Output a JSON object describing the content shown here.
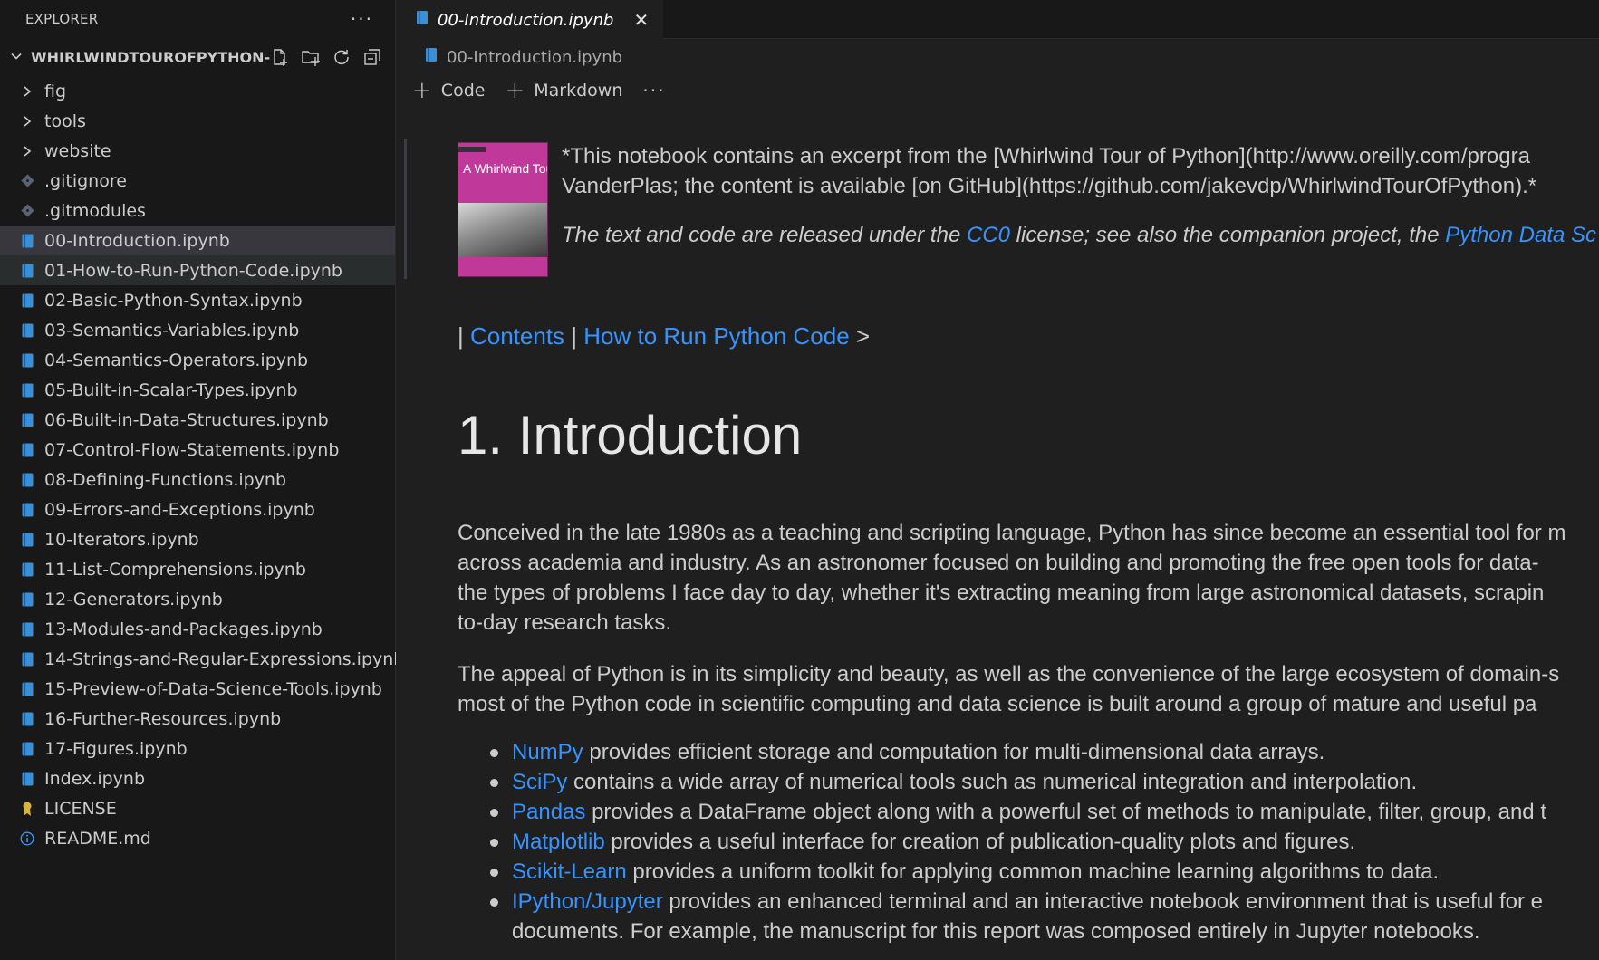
{
  "sidebar": {
    "title": "EXPLORER",
    "more": "···",
    "folder": "WHIRLWINDTOUROFPYTHON-...",
    "items": [
      {
        "label": "fig",
        "type": "folder"
      },
      {
        "label": "tools",
        "type": "folder"
      },
      {
        "label": "website",
        "type": "folder"
      },
      {
        "label": ".gitignore",
        "type": "git"
      },
      {
        "label": ".gitmodules",
        "type": "git"
      },
      {
        "label": "00-Introduction.ipynb",
        "type": "notebook",
        "state": "selected"
      },
      {
        "label": "01-How-to-Run-Python-Code.ipynb",
        "type": "notebook",
        "state": "hover"
      },
      {
        "label": "02-Basic-Python-Syntax.ipynb",
        "type": "notebook"
      },
      {
        "label": "03-Semantics-Variables.ipynb",
        "type": "notebook"
      },
      {
        "label": "04-Semantics-Operators.ipynb",
        "type": "notebook"
      },
      {
        "label": "05-Built-in-Scalar-Types.ipynb",
        "type": "notebook"
      },
      {
        "label": "06-Built-in-Data-Structures.ipynb",
        "type": "notebook"
      },
      {
        "label": "07-Control-Flow-Statements.ipynb",
        "type": "notebook"
      },
      {
        "label": "08-Defining-Functions.ipynb",
        "type": "notebook"
      },
      {
        "label": "09-Errors-and-Exceptions.ipynb",
        "type": "notebook"
      },
      {
        "label": "10-Iterators.ipynb",
        "type": "notebook"
      },
      {
        "label": "11-List-Comprehensions.ipynb",
        "type": "notebook"
      },
      {
        "label": "12-Generators.ipynb",
        "type": "notebook"
      },
      {
        "label": "13-Modules-and-Packages.ipynb",
        "type": "notebook"
      },
      {
        "label": "14-Strings-and-Regular-Expressions.ipynb",
        "type": "notebook"
      },
      {
        "label": "15-Preview-of-Data-Science-Tools.ipynb",
        "type": "notebook"
      },
      {
        "label": "16-Further-Resources.ipynb",
        "type": "notebook"
      },
      {
        "label": "17-Figures.ipynb",
        "type": "notebook"
      },
      {
        "label": "Index.ipynb",
        "type": "notebook"
      },
      {
        "label": "LICENSE",
        "type": "license"
      },
      {
        "label": "README.md",
        "type": "info"
      }
    ]
  },
  "editor": {
    "tab_label": "00-Introduction.ipynb",
    "breadcrumb": "00-Introduction.ipynb",
    "toolbar": {
      "code": "Code",
      "markdown": "Markdown",
      "more": "···"
    }
  },
  "notebook": {
    "cover": {
      "title": "A Whirlwind Tour of Python"
    },
    "intro_line1": "*This notebook contains an excerpt from the [Whirlwind Tour of Python](http://www.oreilly.com/progra",
    "intro_line2": "VanderPlas; the content is available [on GitHub](https://github.com/jakevdp/WhirlwindTourOfPython).*",
    "license": {
      "pre": "The text and code are released under the ",
      "link1": "CC0",
      "mid": " license; see also the companion project, the ",
      "link2": "Python Data Sc"
    },
    "nav": {
      "sep1": "| ",
      "contents": "Contents",
      "sep2": " | ",
      "next": "How to Run Python Code",
      "arrow": " >"
    },
    "heading": "1. Introduction",
    "para1": [
      "Conceived in the late 1980s as a teaching and scripting language, Python has since become an essential tool for m",
      "across academia and industry. As an astronomer focused on building and promoting the free open tools for data-",
      "the types of problems I face day to day, whether it's extracting meaning from large astronomical datasets, scrapin",
      "to-day research tasks."
    ],
    "para2": [
      "The appeal of Python is in its simplicity and beauty, as well as the convenience of the large ecosystem of domain-s",
      "most of the Python code in scientific computing and data science is built around a group of mature and useful pa"
    ],
    "bullets": [
      {
        "link": "NumPy",
        "text": " provides efficient storage and computation for multi-dimensional data arrays."
      },
      {
        "link": "SciPy",
        "text": " contains a wide array of numerical tools such as numerical integration and interpolation."
      },
      {
        "link": "Pandas",
        "text": " provides a DataFrame object along with a powerful set of methods to manipulate, filter, group, and t"
      },
      {
        "link": "Matplotlib",
        "text": " provides a useful interface for creation of publication-quality plots and figures."
      },
      {
        "link": "Scikit-Learn",
        "text": " provides a uniform toolkit for applying common machine learning algorithms to data."
      },
      {
        "link": "IPython/Jupyter",
        "text": " provides an enhanced terminal and an interactive notebook environment that is useful for e",
        "text2": "documents. For example, the manuscript for this report was composed entirely in Jupyter notebooks."
      }
    ]
  },
  "colors": {
    "link": "#3794ff",
    "notebook_icon": "#3a8fd6",
    "git_icon": "#5b6470",
    "license_icon": "#d9b33c",
    "info_icon": "#3794ff"
  }
}
